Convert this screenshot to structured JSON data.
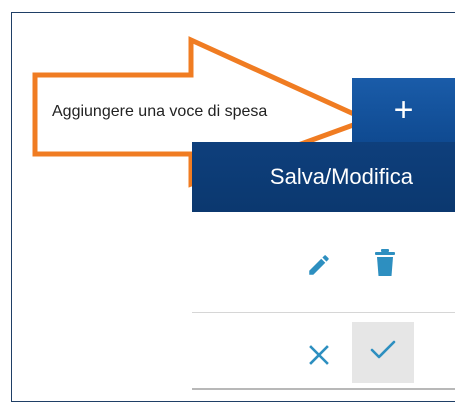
{
  "annotation": {
    "label": "Aggiungere una voce di spesa"
  },
  "toolbar": {
    "add_label": "+",
    "save_label": "Salva/Modifica"
  },
  "colors": {
    "primary": "#1558a7",
    "primary_dark": "#0d3c76",
    "accent": "#2d8fc0",
    "annotation_orange": "#f07c22",
    "frame_border": "#1f3f66"
  },
  "icons": {
    "edit": "pencil-icon",
    "delete": "trash-icon",
    "cancel": "close-icon",
    "confirm": "check-icon"
  }
}
